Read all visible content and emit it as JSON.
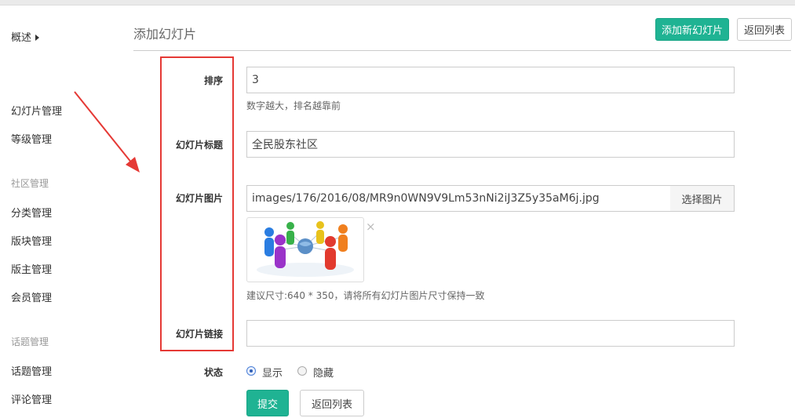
{
  "sidebar": {
    "overview": "概述",
    "items_group1": [
      "幻灯片管理",
      "等级管理"
    ],
    "community_heading": "社区管理",
    "items_group2": [
      "分类管理",
      "版块管理",
      "版主管理",
      "会员管理"
    ],
    "topic_heading": "话题管理",
    "items_group3": [
      "话题管理",
      "评论管理"
    ]
  },
  "header": {
    "title": "添加幻灯片",
    "add_button": "添加新幻灯片",
    "back_button": "返回列表"
  },
  "form": {
    "order_label": "排序",
    "order_value": "3",
    "order_help": "数字越大，排名越靠前",
    "title_label": "幻灯片标题",
    "title_value": "全民股东社区",
    "image_label": "幻灯片图片",
    "image_value": "images/176/2016/08/MR9n0WN9V9Lm53nNi2iJ3Z5y35aM6j.jpg",
    "image_pick_button": "选择图片",
    "image_remove": "×",
    "image_help": "建议尺寸:640 * 350，请将所有幻灯片图片尺寸保持一致",
    "link_label": "幻灯片链接",
    "link_value": "",
    "status_label": "状态",
    "status_options": [
      "显示",
      "隐藏"
    ],
    "status_selected": "显示",
    "submit_button": "提交",
    "back_button": "返回列表"
  },
  "colors": {
    "primary": "#1fb393",
    "annotation": "#e53935"
  }
}
